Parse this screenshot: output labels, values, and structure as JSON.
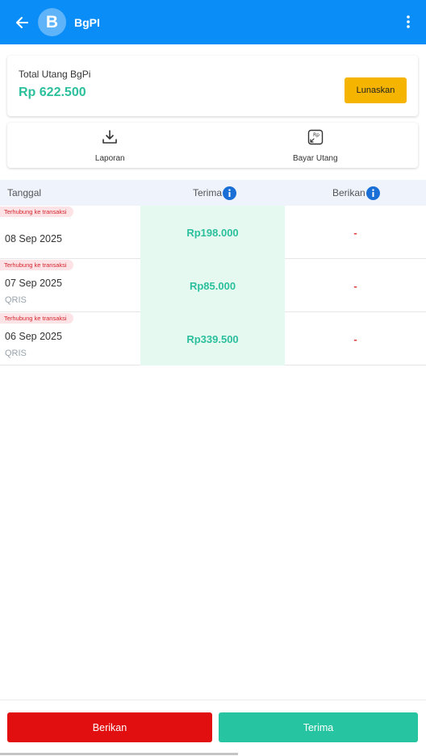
{
  "header": {
    "avatar_letter": "B",
    "title": "BgPI",
    "bg_color": "#0a8df6"
  },
  "summary": {
    "label": "Total Utang BgPi",
    "amount": "Rp 622.500",
    "settle_button": "Lunaskan"
  },
  "actions": [
    {
      "label": "Laporan",
      "icon": "download-icon"
    },
    {
      "label": "Bayar Utang",
      "icon": "rp-pay-icon"
    }
  ],
  "table": {
    "columns": {
      "date": "Tanggal",
      "receive": "Terima",
      "give": "Berikan"
    },
    "rows": [
      {
        "badge": "Terhubung ke transaksi",
        "date": "08 Sep 2025",
        "method": "",
        "receive": "Rp198.000",
        "give": "-"
      },
      {
        "badge": "Terhubung ke transaksi",
        "date": "07 Sep 2025",
        "method": "QRIS",
        "receive": "Rp85.000",
        "give": "-"
      },
      {
        "badge": "Terhubung ke transaksi",
        "date": "06 Sep 2025",
        "method": "QRIS",
        "receive": "Rp339.500",
        "give": "-"
      }
    ]
  },
  "bottom": {
    "give_button": "Berikan",
    "receive_button": "Terima"
  },
  "colors": {
    "accent_green": "#2bbf9c",
    "give_red": "#e10f0f",
    "settle_yellow": "#f4b400"
  }
}
